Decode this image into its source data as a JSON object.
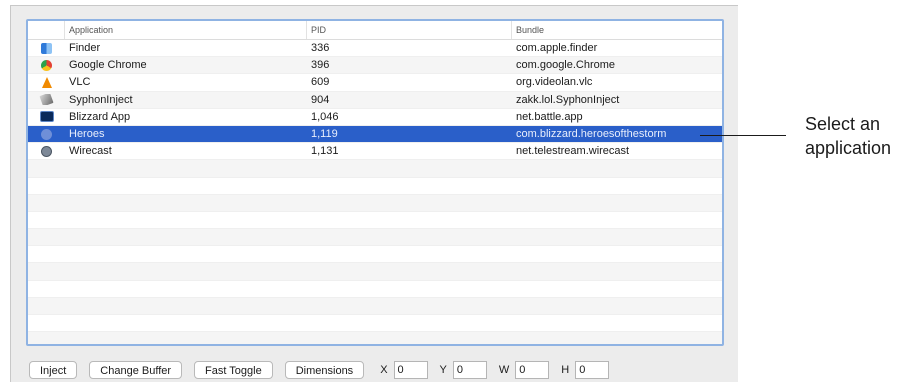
{
  "table": {
    "columns": {
      "application": "Application",
      "pid": "PID",
      "bundle": "Bundle"
    },
    "rows": [
      {
        "icon": "finder-icon",
        "application": "Finder",
        "pid": "336",
        "bundle": "com.apple.finder"
      },
      {
        "icon": "chrome-icon",
        "application": "Google Chrome",
        "pid": "396",
        "bundle": "com.google.Chrome"
      },
      {
        "icon": "vlc-icon",
        "application": "VLC",
        "pid": "609",
        "bundle": "org.videolan.vlc"
      },
      {
        "icon": "syphon-inject-icon",
        "application": "SyphonInject",
        "pid": "904",
        "bundle": "zakk.lol.SyphonInject"
      },
      {
        "icon": "blizzard-app-icon",
        "application": "Blizzard App",
        "pid": "1,046",
        "bundle": "net.battle.app"
      },
      {
        "icon": "heroes-icon",
        "application": "Heroes",
        "pid": "1,119",
        "bundle": "com.blizzard.heroesofthestorm",
        "selected": true
      },
      {
        "icon": "wirecast-icon",
        "application": "Wirecast",
        "pid": "1,131",
        "bundle": "net.telestream.wirecast"
      }
    ],
    "selected_row_color": "#2a5fc9"
  },
  "toolbar": {
    "inject_label": "Inject",
    "change_buffer_label": "Change Buffer",
    "fast_toggle_label": "Fast Toggle",
    "dimensions_label": "Dimensions",
    "x_label": "X",
    "x_value": "0",
    "y_label": "Y",
    "y_value": "0",
    "w_label": "W",
    "w_value": "0",
    "h_label": "H",
    "h_value": "0"
  },
  "annotation": {
    "line1": "Select an",
    "line2": "application"
  }
}
